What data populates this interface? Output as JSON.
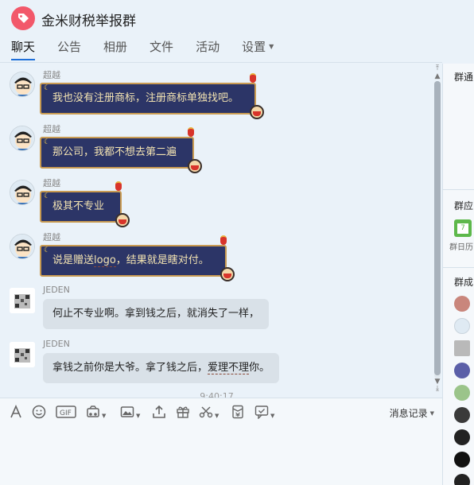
{
  "header": {
    "title": "金米财税举报群",
    "tabs": [
      {
        "label": "聊天"
      },
      {
        "label": "公告"
      },
      {
        "label": "相册"
      },
      {
        "label": "文件"
      },
      {
        "label": "活动"
      },
      {
        "label": "设置"
      }
    ]
  },
  "messages": [
    {
      "sender": "超越",
      "text": "我也没有注册商标，注册商标单独找吧。"
    },
    {
      "sender": "超越",
      "text": "那公司，我都不想去第二遍"
    },
    {
      "sender": "超越",
      "text": "极其不专业"
    },
    {
      "sender": "超越",
      "text_a": "说是赠送",
      "text_b": "logo",
      "text_c": "，结果就是瞎对付。"
    },
    {
      "sender": "JEDEN",
      "text": "何止不专业啊。拿到钱之后，就消失了一样，"
    },
    {
      "sender": "JEDEN",
      "text_a": "拿钱之前你是大爷。拿了钱之后，",
      "text_b": "爱理不理",
      "text_c": "你。"
    }
  ],
  "timestamp": "9:40:17",
  "toolbar": {
    "history_label": "消息记录"
  },
  "right_panel": {
    "notice_title": "群通",
    "apps_title": "群应",
    "calendar_label": "群日历",
    "members_title": "群成"
  },
  "colors": {
    "accent": "#1e6fd9",
    "fancy_bubble": "#2c3567",
    "fancy_border": "#c99b52",
    "gray_bubble": "#d9e1e8"
  }
}
